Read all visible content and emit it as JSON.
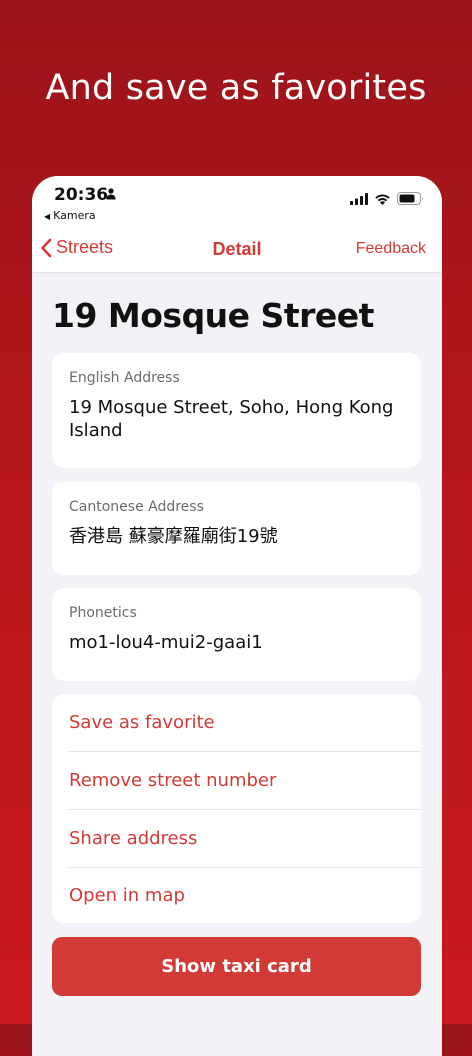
{
  "headline": "And save as favorites",
  "status_bar": {
    "time": "20:36",
    "back_app": "Kamera"
  },
  "nav": {
    "back_label": "Streets",
    "title": "Detail",
    "feedback_label": "Feedback"
  },
  "street_title": "19 Mosque Street",
  "cards": {
    "english": {
      "label": "English Address",
      "value": "19 Mosque Street, Soho, Hong Kong Island"
    },
    "cantonese": {
      "label": "Cantonese Address",
      "value": "香港島 蘇豪摩羅廟街19號"
    },
    "phonetics": {
      "label": "Phonetics",
      "value": "mo1-lou4-mui2-gaai1"
    }
  },
  "actions": [
    {
      "label": "Save as favorite"
    },
    {
      "label": "Remove street number"
    },
    {
      "label": "Share address"
    },
    {
      "label": "Open in map"
    }
  ],
  "taxi_button": "Show taxi card",
  "colors": {
    "accent": "#d23a36",
    "background_top": "#9a1419",
    "background_bottom": "#c9191f"
  }
}
